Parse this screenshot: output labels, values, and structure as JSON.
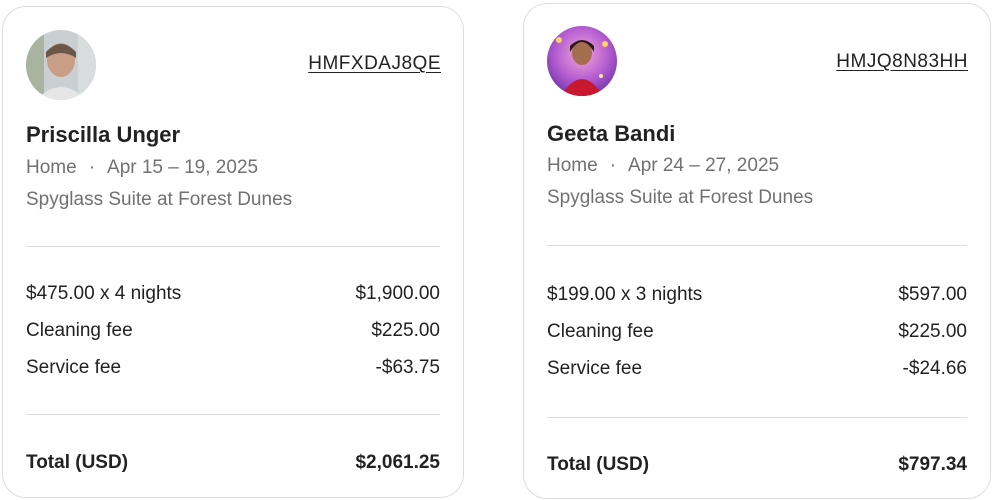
{
  "reservations": [
    {
      "code": "HMFXDAJ8QE",
      "guest_name": "Priscilla Unger",
      "property_type": "Home",
      "separator": "·",
      "dates": "Apr 15 – 19, 2025",
      "listing": "Spyglass Suite at Forest Dunes",
      "line_items": [
        {
          "label": "$475.00 x 4 nights",
          "amount": "$1,900.00"
        },
        {
          "label": "Cleaning fee",
          "amount": "$225.00"
        },
        {
          "label": "Service fee",
          "amount": "-$63.75"
        }
      ],
      "total_label": "Total (USD)",
      "total_amount": "$2,061.25"
    },
    {
      "code": "HMJQ8N83HH",
      "guest_name": "Geeta Bandi",
      "property_type": "Home",
      "separator": "·",
      "dates": "Apr 24 – 27, 2025",
      "listing": "Spyglass Suite at Forest Dunes",
      "line_items": [
        {
          "label": "$199.00 x 3 nights",
          "amount": "$597.00"
        },
        {
          "label": "Cleaning fee",
          "amount": "$225.00"
        },
        {
          "label": "Service fee",
          "amount": "-$24.66"
        }
      ],
      "total_label": "Total (USD)",
      "total_amount": "$797.34"
    }
  ],
  "colors": {
    "text_primary": "#222222",
    "text_secondary": "#717171",
    "border": "#dddddd"
  }
}
